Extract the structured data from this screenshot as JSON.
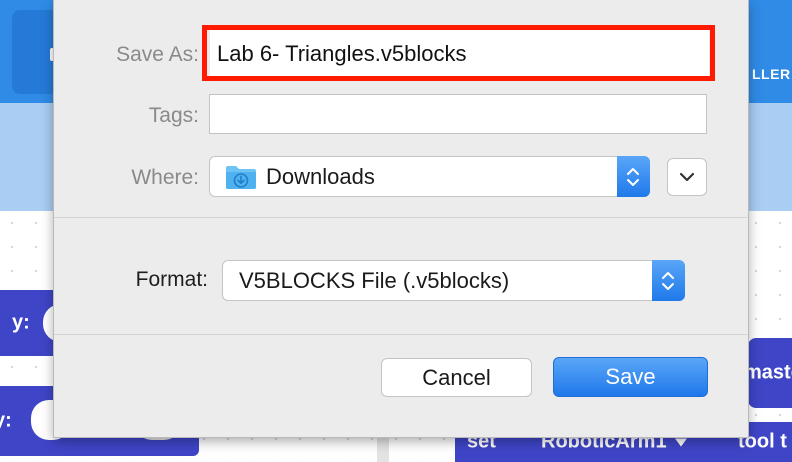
{
  "background": {
    "controller_label_partial": "LLER",
    "blocks": {
      "y_label_1": "y:",
      "y_label_2": "y:",
      "set_label": "set",
      "device_dropdown": "RoboticArm1",
      "tool_label_partial": "tool t",
      "master_label_partial": "maste"
    }
  },
  "dialog": {
    "save_as": {
      "label": "Save As:",
      "value": "Lab 6- Triangles.v5blocks"
    },
    "tags": {
      "label": "Tags:",
      "value": ""
    },
    "where": {
      "label": "Where:",
      "value": "Downloads",
      "icon": "downloads-folder-icon"
    },
    "format": {
      "label": "Format:",
      "value": "V5BLOCKS File (.v5blocks)"
    },
    "buttons": {
      "cancel": "Cancel",
      "save": "Save"
    }
  },
  "colors": {
    "accent": "#2f8be6",
    "highlight": "#ff1a00",
    "block": "#3f45c7"
  }
}
